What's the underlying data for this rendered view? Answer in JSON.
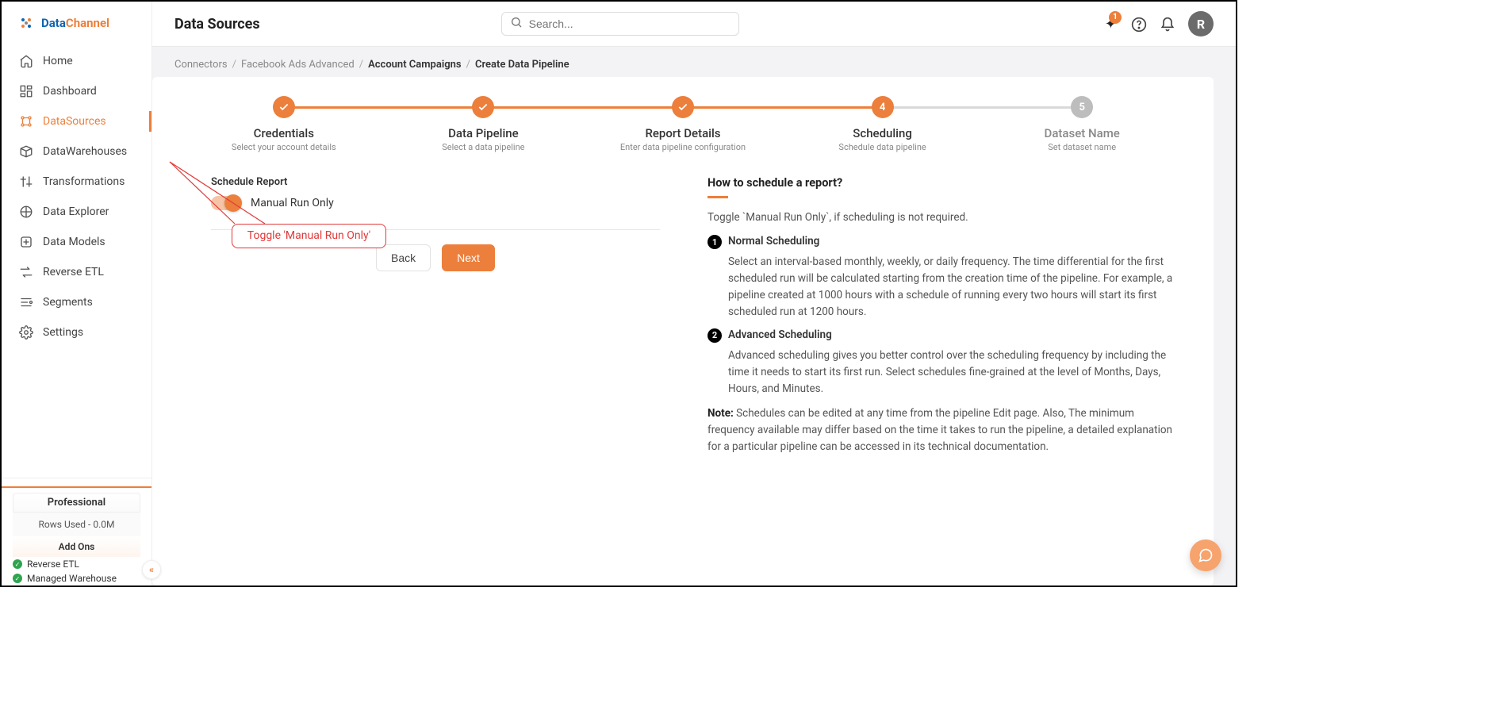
{
  "brand": {
    "blue": "Data",
    "orange": "Channel"
  },
  "nav": [
    {
      "label": "Home",
      "icon": "home"
    },
    {
      "label": "Dashboard",
      "icon": "dashboard"
    },
    {
      "label": "DataSources",
      "icon": "datasources",
      "active": true
    },
    {
      "label": "DataWarehouses",
      "icon": "warehouses"
    },
    {
      "label": "Transformations",
      "icon": "transformations"
    },
    {
      "label": "Data Explorer",
      "icon": "explorer"
    },
    {
      "label": "Data Models",
      "icon": "models"
    },
    {
      "label": "Reverse ETL",
      "icon": "reverse"
    },
    {
      "label": "Segments",
      "icon": "segments"
    },
    {
      "label": "Settings",
      "icon": "settings"
    }
  ],
  "plan": {
    "name": "Professional",
    "rows": "Rows Used - 0.0M",
    "addons_title": "Add Ons",
    "addons": [
      "Reverse ETL",
      "Managed Warehouse"
    ]
  },
  "header": {
    "title": "Data Sources",
    "search_placeholder": "Search...",
    "notif_count": "1",
    "avatar": "R"
  },
  "breadcrumb": [
    "Connectors",
    "Facebook Ads Advanced",
    "Account Campaigns",
    "Create Data Pipeline"
  ],
  "steps": [
    {
      "title": "Credentials",
      "sub": "Select your account details",
      "state": "done"
    },
    {
      "title": "Data Pipeline",
      "sub": "Select a data pipeline",
      "state": "done"
    },
    {
      "title": "Report Details",
      "sub": "Enter data pipeline configuration",
      "state": "done"
    },
    {
      "title": "Scheduling",
      "sub": "Schedule data pipeline",
      "state": "current",
      "num": "4"
    },
    {
      "title": "Dataset Name",
      "sub": "Set dataset name",
      "state": "pending",
      "num": "5"
    }
  ],
  "left": {
    "section_label": "Schedule Report",
    "toggle_label": "Manual Run Only",
    "back": "Back",
    "next": "Next",
    "annotation": "Toggle 'Manual Run Only'"
  },
  "help": {
    "title": "How to schedule a report?",
    "intro": "Toggle `Manual Run Only`, if scheduling is not required.",
    "n1_title": "Normal Scheduling",
    "n1_body": "Select an interval-based monthly, weekly, or daily frequency. The time differential for the first scheduled run will be calculated starting from the creation time of the pipeline. For example, a pipeline created at 1000 hours with a schedule of running every two hours will start its first scheduled run at 1200 hours.",
    "n2_title": "Advanced Scheduling",
    "n2_body": "Advanced scheduling gives you better control over the scheduling frequency by including the time it needs to start its first run. Select schedules fine-grained at the level of Months, Days, Hours, and Minutes.",
    "note_label": "Note:",
    "note": " Schedules can be edited at any time from the pipeline Edit page. Also, The minimum frequency available may differ based on the time it takes to run the pipeline, a detailed explanation for a particular pipeline can be accessed in its technical documentation."
  }
}
